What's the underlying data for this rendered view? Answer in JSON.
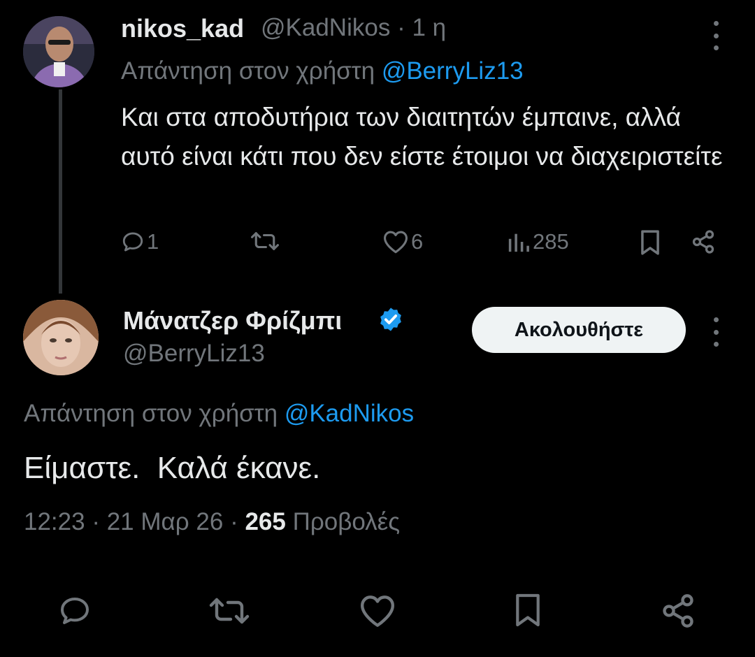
{
  "tweet1": {
    "display_name": "nikos_kad",
    "handle": "@KadNikos",
    "separator": "·",
    "time_ago": "1 η",
    "replying_prefix": "Απάντηση στον χρήστη",
    "replying_to": "@BerryLiz13",
    "text": "Και στα αποδυτήρια των διαιτητών έμπαινε, αλλά αυτό είναι κάτι που δεν είστε έτοιμοι να διαχειριστείτε",
    "actions": {
      "replies": "1",
      "retweets": "",
      "likes": "6",
      "views": "285"
    }
  },
  "tweet2": {
    "display_name": "Μάνατζερ Φρίζμπι",
    "handle": "@BerryLiz13",
    "follow_label": "Ακολουθήστε",
    "replying_prefix": "Απάντηση στον χρήστη",
    "replying_to": "@KadNikos",
    "text": "Είμαστε.  Καλά έκανε.",
    "time": "12:23",
    "separator": "·",
    "date": "21 Μαρ 26",
    "views_count": "265",
    "views_label": "Προβολές"
  },
  "icons": {
    "more": "more-vertical-icon",
    "verified": "verified-badge-icon",
    "reply": "reply-icon",
    "retweet": "retweet-icon",
    "like": "heart-icon",
    "views": "views-icon",
    "bookmark": "bookmark-icon",
    "share": "share-icon"
  },
  "colors": {
    "background": "#000000",
    "text": "#e7e9ea",
    "secondary": "#71767b",
    "accent": "#1d9bf0",
    "button_bg": "#eff3f4"
  }
}
